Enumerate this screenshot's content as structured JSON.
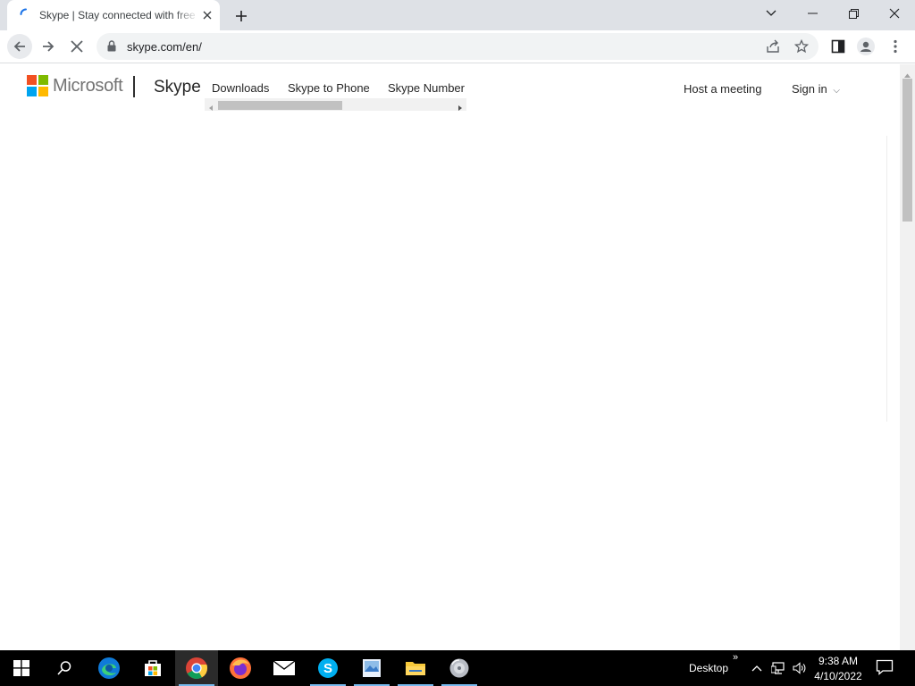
{
  "browser": {
    "tab_title": "Skype | Stay connected with free video calls worldwide",
    "url": "skype.com/en/"
  },
  "site": {
    "microsoft_label": "Microsoft",
    "skype_label": "Skype",
    "nav": [
      "Downloads",
      "Skype to Phone",
      "Skype Number"
    ],
    "host_meeting": "Host a meeting",
    "sign_in": "Sign in",
    "sign_in_chevron": "⌵"
  },
  "ms_logo_colors": [
    "#f25022",
    "#7fba00",
    "#00a4ef",
    "#ffb900"
  ],
  "taskbar": {
    "desktop_label": "Desktop",
    "desktop_chevron": "»",
    "time": "9:38 AM",
    "date": "4/10/2022",
    "apps": [
      "start-icon",
      "search-icon",
      "edge-icon",
      "store-icon",
      "chrome-icon",
      "firefox-icon",
      "mail-icon",
      "skype-icon",
      "photo-viewer-icon",
      "file-explorer-icon",
      "disc-icon"
    ]
  }
}
